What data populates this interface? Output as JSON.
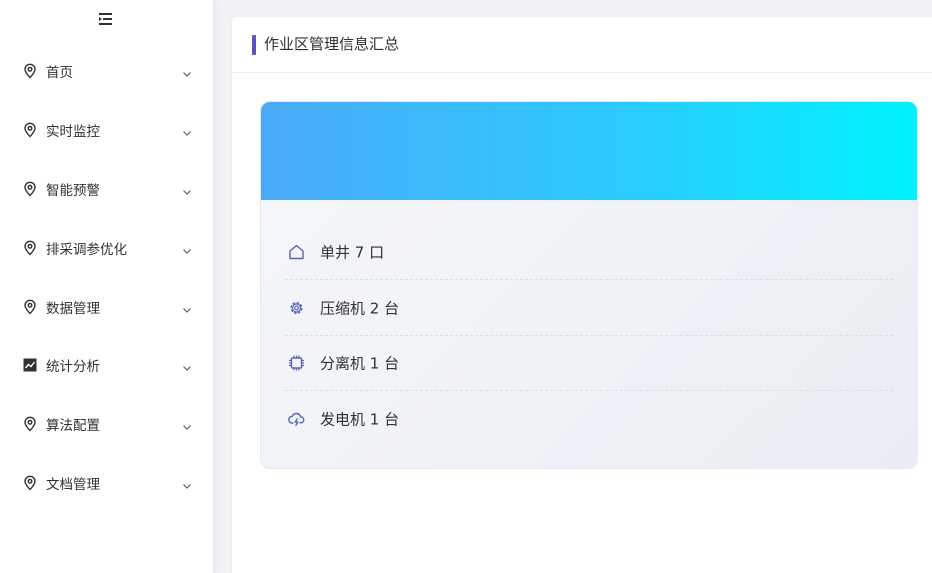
{
  "sidebar": {
    "items": [
      {
        "label": "首页",
        "icon": "location-pin-icon"
      },
      {
        "label": "实时监控",
        "icon": "location-pin-icon"
      },
      {
        "label": "智能预警",
        "icon": "location-pin-icon"
      },
      {
        "label": "排采调参优化",
        "icon": "location-pin-icon"
      },
      {
        "label": "数据管理",
        "icon": "location-pin-icon"
      },
      {
        "label": "统计分析",
        "icon": "trend-chart-icon"
      },
      {
        "label": "算法配置",
        "icon": "location-pin-icon"
      },
      {
        "label": "文档管理",
        "icon": "location-pin-icon"
      }
    ]
  },
  "main": {
    "title": "作业区管理信息汇总",
    "site": {
      "name": "",
      "stats": [
        {
          "text": "单井 7 口",
          "icon": "house-icon"
        },
        {
          "text": "压缩机 2 台",
          "icon": "gear-icon"
        },
        {
          "text": "分离机 1 台",
          "icon": "chip-icon"
        },
        {
          "text": "发电机 1 台",
          "icon": "cloud-lightning-icon"
        }
      ]
    }
  },
  "colors": {
    "accent": "#5b52c8",
    "icon": "#5a64b4",
    "banner_start": "#4aaaf8",
    "banner_end": "#00f2fd"
  }
}
